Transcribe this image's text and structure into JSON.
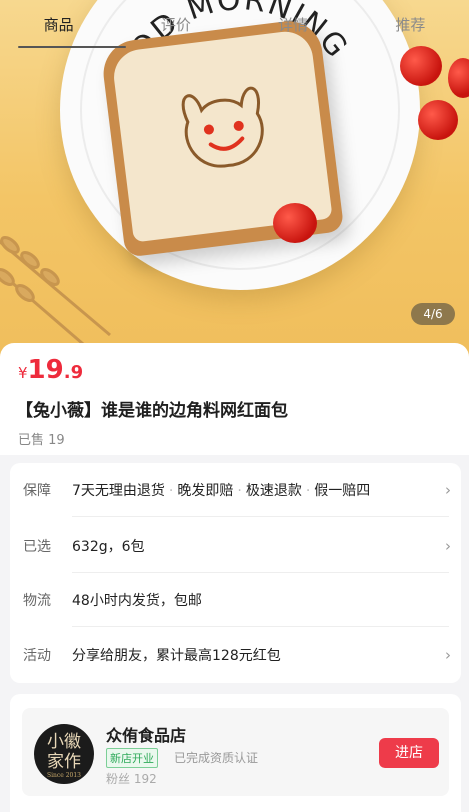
{
  "tabs": [
    "商品",
    "评价",
    "详情",
    "推荐"
  ],
  "hero": {
    "plate_text": "GOOD MORNING",
    "page_indicator": "4/6"
  },
  "product": {
    "currency": "¥",
    "price_int": "19",
    "price_dec": ".9",
    "title": "【兔小薇】谁是谁的边角料网红面包",
    "sold": "已售 19"
  },
  "info_rows": {
    "guarantee": {
      "label": "保障",
      "items": [
        "7天无理由退货",
        "晚发即赔",
        "极速退款",
        "假一赔四"
      ]
    },
    "selected": {
      "label": "已选",
      "value": "632g，6包"
    },
    "shipping": {
      "label": "物流",
      "value": "48小时内发货，包邮"
    },
    "activity": {
      "label": "活动",
      "value": "分享给朋友，累计最高128元红包"
    }
  },
  "store": {
    "logo_line1": "小徽",
    "logo_line2": "家作",
    "logo_since": "Since 2013",
    "name": "众侑食品店",
    "badge_new": "新店开业",
    "badge_verified": "已完成资质认证",
    "fans": "粉丝 192",
    "enter_label": "进店"
  },
  "colors": {
    "price": "#ee2b3c",
    "enter_button": "#ee3b4a",
    "badge_green": "#2faa5a"
  }
}
